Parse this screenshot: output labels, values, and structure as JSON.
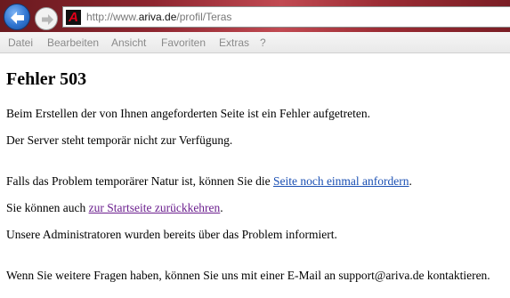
{
  "browser": {
    "url_prefix": "http://www.",
    "url_domain": "ariva.de",
    "url_path": "/profil/Teras",
    "favicon_letter": "A",
    "menu": [
      "Datei",
      "Bearbeiten",
      "Ansicht",
      "Favoriten",
      "Extras",
      "?"
    ]
  },
  "page": {
    "title": "Fehler 503",
    "line1": "Beim Erstellen der von Ihnen angeforderten Seite ist ein Fehler aufgetreten.",
    "line2": "Der Server steht temporär nicht zur Verfügung.",
    "line3_prefix": "Falls das Problem temporärer Natur ist, können Sie die ",
    "line3_link": "Seite noch einmal anfordern",
    "line3_suffix": ".",
    "line4_prefix": "Sie können auch ",
    "line4_link": "zur Startseite zurückkehren",
    "line4_suffix": ".",
    "line5": "Unsere Administratoren wurden bereits über das Problem informiert.",
    "line6": "Wenn Sie weitere Fragen haben, können Sie uns mit einer E-Mail an support@ariva.de kontaktieren."
  }
}
